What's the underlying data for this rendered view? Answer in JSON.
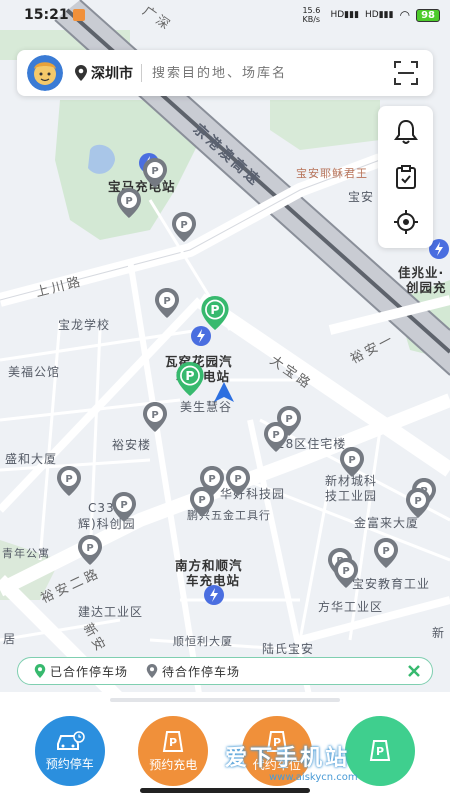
{
  "status_bar": {
    "time": "15:21",
    "speed": "15.6 KB/s",
    "battery": "98"
  },
  "search": {
    "city": "深圳市",
    "placeholder": "搜索目的地、场库名"
  },
  "map": {
    "labels": {
      "guangshen": "广深",
      "highway": "京港澳高速",
      "baoma": "宝马充电站",
      "shangchuan": "上川路",
      "baolong": "宝龙学校",
      "wayao": "瓦窑花园汽",
      "wayao2": "车充电站",
      "meisheng": "美生慧谷",
      "dabao": "大宝路",
      "yuan_yi": "裕安一路",
      "meifu": "美福公馆",
      "shenghe": "盛和大厦",
      "yuan_lou": "裕安楼",
      "zone28": "28区住宅楼",
      "xinchengke": "新材城科",
      "xinchengke2": "技工业园",
      "chenghao": "C33城",
      "chenghao2": "辉)科创园",
      "science": "华好科技园",
      "hardware": "鹏兴五金工具行",
      "jinfu": "金富来大厦",
      "qingnian": "青年公寓",
      "yuan_er": "裕安二路",
      "nanfang": "南方和顺汽",
      "nanfang2": "车充电站",
      "education": "宝安教育工业",
      "jianda": "建达工业区",
      "xinan": "新安",
      "fanghua": "方华工业区",
      "shunxin": "顺恒利大厦",
      "luchen": "陆氏宝安",
      "ju": "居",
      "jiaoyuzhong": "宝安耶稣君王",
      "baoan_r": "宝安",
      "jiazhao": "佳兆业·",
      "chuangyuan": "创园充",
      "baoan2": "宝安",
      "xin": "新",
      "yunan_road2": "裕安一"
    }
  },
  "side_tools": [
    "bell-icon",
    "clipboard-icon",
    "locate-icon"
  ],
  "legend": {
    "cooperative": "已合作停车场",
    "pending": "待合作停车场"
  },
  "actions": [
    {
      "label": "预约停车",
      "color": "#2b8fde"
    },
    {
      "label": "预约充电",
      "color": "#f0903a"
    },
    {
      "label": "代约车位",
      "color": "#f0903a"
    },
    {
      "label": "",
      "color": "#3fcf8e"
    }
  ],
  "watermark": {
    "main": "爱下手机站",
    "sub": "www.aiskycn.com"
  },
  "colors": {
    "green_pin": "#37b96e",
    "gray_pin": "#757a82",
    "charge_blue": "#4a6ee0",
    "brand_blue": "#2b8fde"
  }
}
